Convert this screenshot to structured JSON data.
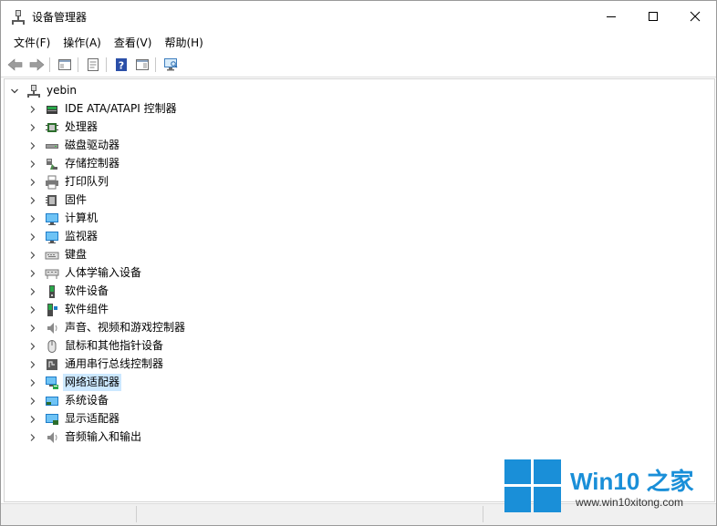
{
  "window": {
    "title": "设备管理器",
    "minimize_glyph": "—",
    "maximize_glyph": "☐",
    "close_glyph": "✕"
  },
  "menu": [
    {
      "label": "文件(F)"
    },
    {
      "label": "操作(A)"
    },
    {
      "label": "查看(V)"
    },
    {
      "label": "帮助(H)"
    }
  ],
  "toolbar": {
    "buttons": [
      "back-icon",
      "forward-icon",
      "show-hide-tree-icon",
      "properties-icon",
      "help-icon",
      "action-pane-icon",
      "scan-hardware-icon"
    ]
  },
  "tree": {
    "root": {
      "label": "yebin",
      "icon": "computer-root-icon",
      "expanded": true
    },
    "items": [
      {
        "label": "IDE ATA/ATAPI 控制器",
        "icon": "ide-controller-icon"
      },
      {
        "label": "处理器",
        "icon": "processor-icon"
      },
      {
        "label": "磁盘驱动器",
        "icon": "disk-drive-icon"
      },
      {
        "label": "存储控制器",
        "icon": "storage-controller-icon"
      },
      {
        "label": "打印队列",
        "icon": "printer-icon"
      },
      {
        "label": "固件",
        "icon": "firmware-icon"
      },
      {
        "label": "计算机",
        "icon": "computer-icon"
      },
      {
        "label": "监视器",
        "icon": "monitor-icon"
      },
      {
        "label": "键盘",
        "icon": "keyboard-icon"
      },
      {
        "label": "人体学输入设备",
        "icon": "hid-icon"
      },
      {
        "label": "软件设备",
        "icon": "software-device-icon"
      },
      {
        "label": "软件组件",
        "icon": "software-component-icon"
      },
      {
        "label": "声音、视频和游戏控制器",
        "icon": "sound-icon"
      },
      {
        "label": "鼠标和其他指针设备",
        "icon": "mouse-icon"
      },
      {
        "label": "通用串行总线控制器",
        "icon": "usb-icon"
      },
      {
        "label": "网络适配器",
        "icon": "network-adapter-icon",
        "selected": true
      },
      {
        "label": "系统设备",
        "icon": "system-device-icon"
      },
      {
        "label": "显示适配器",
        "icon": "display-adapter-icon"
      },
      {
        "label": "音频输入和输出",
        "icon": "audio-io-icon"
      }
    ]
  },
  "watermark": {
    "title": "Win10 之家",
    "url": "www.win10xitong.com",
    "colors": {
      "logo": "#1a8fd8"
    }
  },
  "colors": {
    "selection": "#cce8ff",
    "accent": "#1a8fd8"
  }
}
